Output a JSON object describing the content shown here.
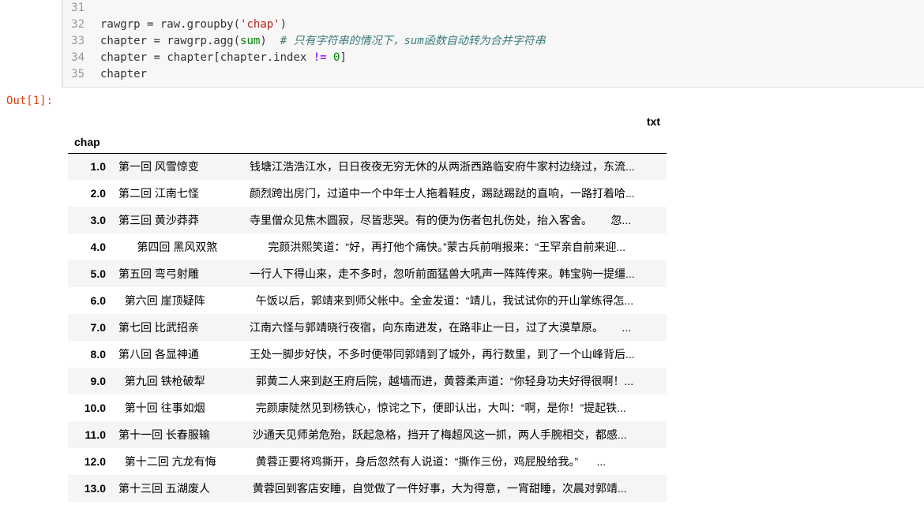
{
  "code_cell": {
    "line_numbers": [
      "31",
      "32",
      "33",
      "34",
      "35"
    ],
    "lines": [
      [],
      [
        {
          "t": "id",
          "v": "rawgrp"
        },
        {
          "t": "op",
          "v": " = "
        },
        {
          "t": "id",
          "v": "raw.groupby("
        },
        {
          "t": "str",
          "v": "'chap'"
        },
        {
          "t": "op",
          "v": ")"
        }
      ],
      [
        {
          "t": "id",
          "v": "chapter"
        },
        {
          "t": "op",
          "v": " = "
        },
        {
          "t": "id",
          "v": "rawgrp.agg("
        },
        {
          "t": "builtin",
          "v": "sum"
        },
        {
          "t": "op",
          "v": ")  "
        },
        {
          "t": "comment",
          "v": "# 只有字符串的情况下，sum函数自动转为合并字符串"
        }
      ],
      [
        {
          "t": "id",
          "v": "chapter"
        },
        {
          "t": "op",
          "v": " = "
        },
        {
          "t": "id",
          "v": "chapter[chapter.index "
        },
        {
          "t": "neq",
          "v": "!="
        },
        {
          "t": "op",
          "v": " "
        },
        {
          "t": "num",
          "v": "0"
        },
        {
          "t": "op",
          "v": "]"
        }
      ],
      [
        {
          "t": "id",
          "v": "chapter"
        }
      ]
    ]
  },
  "output": {
    "prompt": "Out[1]:",
    "column_header": "txt",
    "index_header": "chap",
    "rows": [
      {
        "idx": "1.0",
        "title": "第一回 风雪惊变",
        "text": "钱塘江浩浩江水，日日夜夜无穷无休的从两浙西路临安府牛家村边绕过，东流..."
      },
      {
        "idx": "2.0",
        "title": "第二回 江南七怪",
        "text": "颜烈跨出房门，过道中一个中年士人拖着鞋皮，踢跶踢跶的直响，一路打着哈..."
      },
      {
        "idx": "3.0",
        "title": "第三回 黄沙莽莽",
        "text": "寺里僧众见焦木圆寂，尽皆悲哭。有的便为伤者包扎伤处，抬入客舍。      忽..."
      },
      {
        "idx": "4.0",
        "title": "      第四回 黑风双煞",
        "text": "      完颜洪熙笑道：“好，再打他个痛快。”蒙古兵前哨报来：“王罕亲自前来迎..."
      },
      {
        "idx": "5.0",
        "title": "第五回 弯弓射雕",
        "text": "一行人下得山来，走不多时，忽听前面猛兽大吼声一阵阵传来。韩宝驹一提缰..."
      },
      {
        "idx": "6.0",
        "title": "  第六回 崖顶疑阵",
        "text": "  午饭以后，郭靖来到师父帐中。全金发道：“靖儿，我试试你的开山掌练得怎..."
      },
      {
        "idx": "7.0",
        "title": "第七回 比武招亲",
        "text": "江南六怪与郭靖晓行夜宿，向东南进发，在路非止一日，过了大漠草原。      ..."
      },
      {
        "idx": "8.0",
        "title": "第八回 各显神通",
        "text": "王处一脚步好快，不多时便带同郭靖到了城外，再行数里，到了一个山峰背后..."
      },
      {
        "idx": "9.0",
        "title": "  第九回 铁枪破犁",
        "text": "  郭黄二人来到赵王府后院，越墙而进，黄蓉柔声道：“你轻身功夫好得很啊！..."
      },
      {
        "idx": "10.0",
        "title": "  第十回 往事如烟",
        "text": "  完颜康陡然见到杨铁心，惊诧之下，便即认出，大叫：“啊，是你！”提起铁..."
      },
      {
        "idx": "11.0",
        "title": "第十一回 长春服输",
        "text": " 沙通天见师弟危殆，跃起急格，挡开了梅超风这一抓，两人手腕相交，都感..."
      },
      {
        "idx": "12.0",
        "title": "  第十二回 亢龙有悔",
        "text": "  黄蓉正要将鸡撕开，身后忽然有人说道：“撕作三份，鸡屁股给我。”      ..."
      },
      {
        "idx": "13.0",
        "title": "第十三回 五湖废人",
        "text": " 黄蓉回到客店安睡，自觉做了一件好事，大为得意，一宵甜睡，次晨对郭靖..."
      }
    ]
  }
}
